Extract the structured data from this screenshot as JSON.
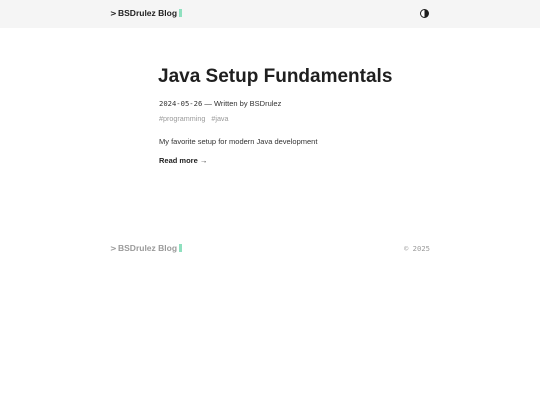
{
  "header": {
    "prompt_glyph": ">",
    "brand": "BSDrulez Blog",
    "theme_toggle_icon": "contrast-icon"
  },
  "post": {
    "title": "Java Setup Fundamentals",
    "date": "2024-05-26",
    "byline": "— Written by BSDrulez",
    "tags": [
      "#programming",
      "#java"
    ],
    "excerpt": "My favorite setup for modern Java development",
    "read_more": "Read more →"
  },
  "footer": {
    "prompt_glyph": ">",
    "brand": "BSDrulez Blog",
    "copyright": "© 2025"
  },
  "colors": {
    "header_bg": "#f5f5f5",
    "text": "#1f1f1f",
    "muted": "#9a9a9a",
    "cursor_accent": "#8fe0bf"
  }
}
